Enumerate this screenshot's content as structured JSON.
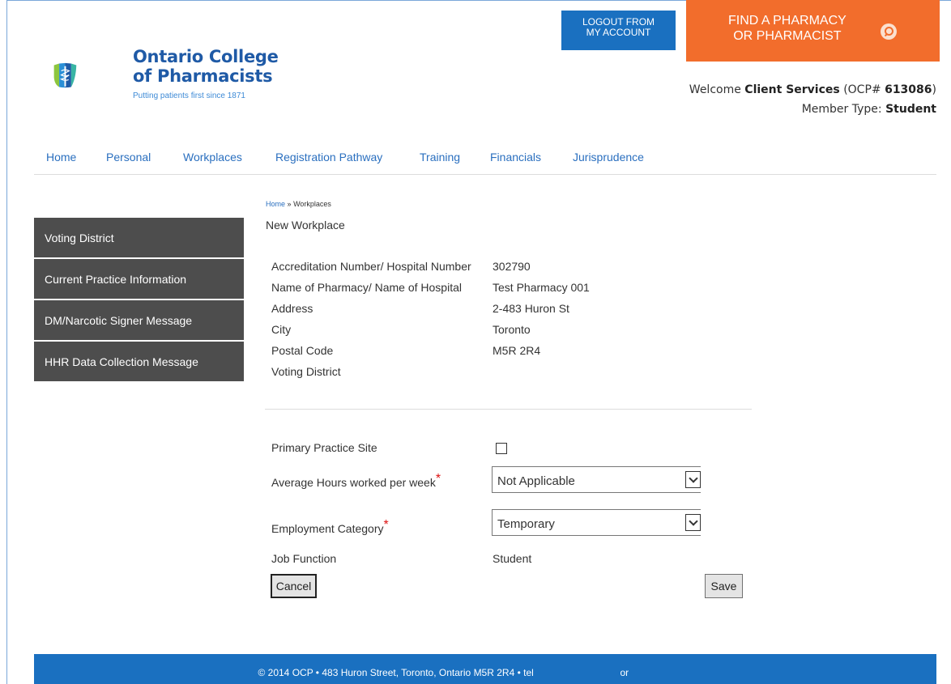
{
  "header": {
    "logo": {
      "line1": "Ontario College",
      "line2": "of Pharmacists",
      "tagline": "Putting patients first since 1871"
    },
    "logout_label_line1": "LOGOUT FROM",
    "logout_label_line2": "MY ACCOUNT",
    "find_label_line1": "FIND A PHARMACY",
    "find_label_line2": "OR PHARMACIST",
    "welcome_prefix": "Welcome",
    "welcome_name": "Client Services",
    "welcome_ocp_prefix": "(OCP#",
    "welcome_ocp_number": "613086",
    "welcome_ocp_suffix": ")",
    "member_type_label": "Member Type:",
    "member_type_value": "Student",
    "colors": {
      "logout_bg": "#1a70c0",
      "find_bg": "#f26d2c"
    }
  },
  "nav": {
    "items": [
      "Home",
      "Personal",
      "Workplaces",
      "Registration Pathway",
      "Training",
      "Financials",
      "Jurisprudence"
    ]
  },
  "sidebar": {
    "items": [
      "Voting District",
      "Current Practice Information",
      "DM/Narcotic Signer Message",
      "HHR Data Collection Message"
    ]
  },
  "breadcrumb": {
    "home": "Home",
    "separator": "»",
    "current": "Workplaces"
  },
  "page_title": "New Workplace",
  "workplace_info": {
    "rows": [
      {
        "label": "Accreditation Number/ Hospital Number",
        "value": "302790"
      },
      {
        "label": "Name of Pharmacy/ Name of Hospital",
        "value": "Test Pharmacy 001"
      },
      {
        "label": "Address",
        "value": "2-483 Huron St"
      },
      {
        "label": "City",
        "value": "Toronto"
      },
      {
        "label": "Postal Code",
        "value": "M5R 2R4"
      },
      {
        "label": "Voting District",
        "value": ""
      }
    ]
  },
  "form": {
    "primary_site_label": "Primary Practice Site",
    "primary_site_checked": false,
    "avg_hours_label": "Average Hours worked per week",
    "avg_hours_value": "Not Applicable",
    "employment_label": "Employment Category",
    "employment_value": "Temporary",
    "required_mark": "*",
    "job_function_label": "Job Function",
    "job_function_value": "Student",
    "cancel_label": "Cancel",
    "save_label": "Save"
  },
  "footer": {
    "text": "© 2014 OCP • 483 Huron Street, Toronto, Ontario M5R 2R4 • tel",
    "or": "or"
  }
}
